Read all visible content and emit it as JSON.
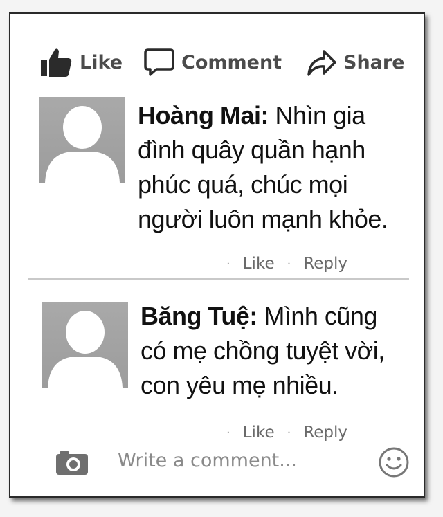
{
  "actions": {
    "like_label": "Like",
    "comment_label": "Comment",
    "share_label": "Share"
  },
  "comments": [
    {
      "author": "Hoàng Mai:",
      "text_lines": [
        " Nhìn gia",
        "đình quây quần hạnh",
        "phúc quá, chúc mọi",
        "người luôn mạnh khỏe."
      ],
      "like_label": "Like",
      "reply_label": "Reply"
    },
    {
      "author": "Băng Tuệ:",
      "text_lines": [
        " Mình cũng",
        "có mẹ chồng tuyệt vời,",
        "con yêu mẹ nhiều."
      ],
      "like_label": "Like",
      "reply_label": "Reply"
    }
  ],
  "composer": {
    "placeholder": "Write a comment..."
  },
  "icons": {
    "like": "thumbs-up-icon",
    "comment": "speech-bubble-icon",
    "share": "share-arrow-icon",
    "camera": "camera-icon",
    "emoji": "smiley-icon"
  }
}
